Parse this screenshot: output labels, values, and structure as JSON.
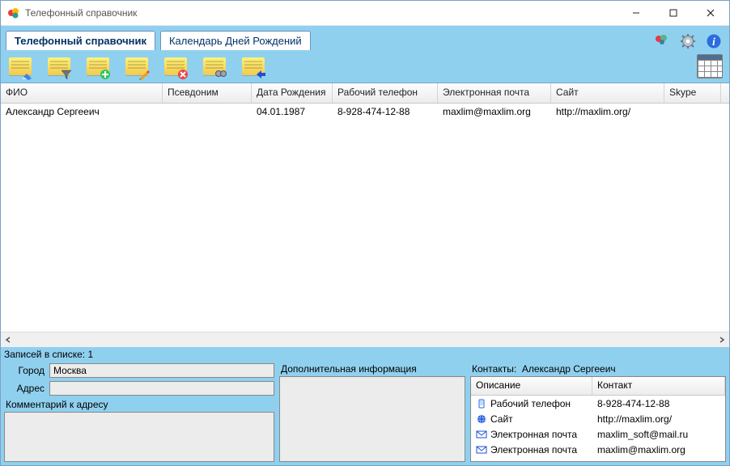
{
  "window": {
    "title": "Телефонный справочник"
  },
  "tabs": {
    "phonebook": "Телефонный справочник",
    "calendar": "Календарь Дней Рождений"
  },
  "toolbar": {
    "clear": "clear",
    "filter": "filter",
    "add": "add",
    "edit": "edit",
    "delete": "delete",
    "search": "search",
    "export": "export"
  },
  "grid": {
    "headers": {
      "fio": "ФИО",
      "nickname": "Псевдоним",
      "dob": "Дата Рождения",
      "work_phone": "Рабочий телефон",
      "email": "Электронная почта",
      "site": "Сайт",
      "skype": "Skype"
    },
    "rows": [
      {
        "fio": "Александр Сергееич",
        "nickname": "",
        "dob": "04.01.1987",
        "work_phone": "8-928-474-12-88",
        "email": "maxlim@maxlim.org",
        "site": "http://maxlim.org/",
        "skype": ""
      }
    ]
  },
  "status": {
    "records_label": "Записей в списке: 1"
  },
  "address": {
    "city_label": "Город",
    "city_value": "Москва",
    "address_label": "Адрес",
    "address_value": "",
    "comment_label": "Комментарий к адресу",
    "comment_value": ""
  },
  "extra": {
    "label": "Дополнительная информация",
    "value": ""
  },
  "contacts": {
    "label_prefix": "Контакты:",
    "person": "Александр Сергееич",
    "headers": {
      "desc": "Описание",
      "contact": "Контакт"
    },
    "rows": [
      {
        "icon": "phone",
        "desc": "Рабочий телефон",
        "contact": "8-928-474-12-88"
      },
      {
        "icon": "globe",
        "desc": "Сайт",
        "contact": "http://maxlim.org/"
      },
      {
        "icon": "mail",
        "desc": "Электронная почта",
        "contact": "maxlim_soft@mail.ru"
      },
      {
        "icon": "mail",
        "desc": "Электронная почта",
        "contact": "maxlim@maxlim.org"
      }
    ]
  }
}
